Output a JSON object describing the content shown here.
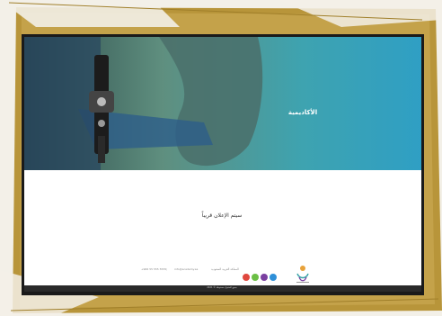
{
  "hero": {
    "title": "الأكاديمية"
  },
  "main": {
    "coming_soon": "سيتم الإعلان قريباً"
  },
  "footer": {
    "contact_1": "+966 55 555 5555",
    "contact_2": "info@academy.sa",
    "address": "المملكة العربية السعودية",
    "socials": [
      {
        "name": "instagram-icon",
        "color": "#e0483e"
      },
      {
        "name": "twitter-icon",
        "color": "#6bbf45"
      },
      {
        "name": "snapchat-icon",
        "color": "#7a3fa0"
      },
      {
        "name": "youtube-icon",
        "color": "#2e8fd8"
      }
    ],
    "copyright": "جميع الحقوق محفوظة © 2021"
  },
  "colors": {
    "frame_gold": "#b8953a",
    "screen_bezel": "#1a1a1a",
    "hero_teal": "#3aa3a8"
  }
}
